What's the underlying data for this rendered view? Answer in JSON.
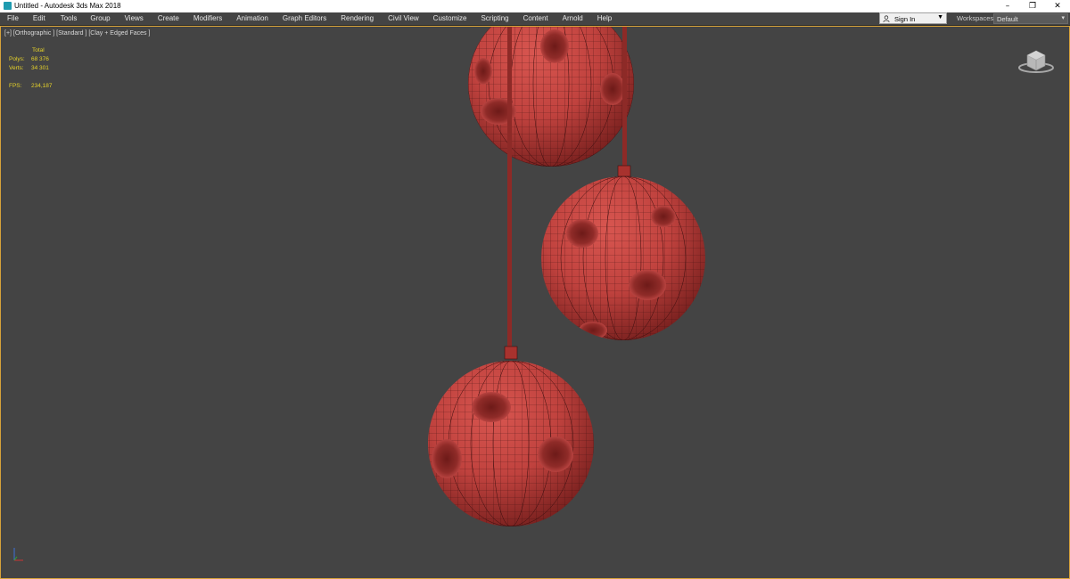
{
  "window": {
    "title": "Untitled - Autodesk 3ds Max 2018",
    "controls": {
      "minimize": "–",
      "restore": "❐",
      "close": "✕"
    }
  },
  "menubar": {
    "items": [
      "File",
      "Edit",
      "Tools",
      "Group",
      "Views",
      "Create",
      "Modifiers",
      "Animation",
      "Graph Editors",
      "Rendering",
      "Civil View",
      "Customize",
      "Scripting",
      "Content",
      "Arnold",
      "Help"
    ]
  },
  "account": {
    "sign_in_label": "Sign In",
    "dropdown_icon": "caret-down-icon"
  },
  "workspaces": {
    "label": "Workspaces:",
    "value": "Default"
  },
  "viewport": {
    "label": "[+] [Orthographic ] [Standard ] [Clay + Edged Faces ]",
    "stats": {
      "header": "Total",
      "polys_label": "Polys:",
      "polys_value": "68 376",
      "verts_label": "Verts:",
      "verts_value": "34 301",
      "fps_label": "FPS:",
      "fps_value": "234,187"
    },
    "object_color": "#c84a46",
    "wire_color": "#3a0e0e",
    "background_color": "#444444",
    "border_color": "#d6a23a"
  }
}
